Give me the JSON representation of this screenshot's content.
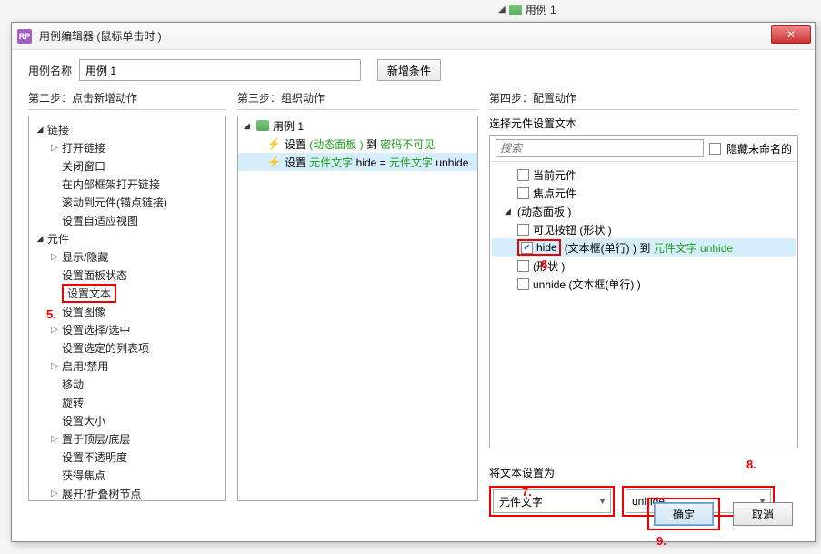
{
  "bg": {
    "usecase": "用例 1"
  },
  "dialog": {
    "app_icon_text": "RP",
    "title": "用例编辑器 (鼠标单击时  )",
    "close": "✕",
    "name_label": "用例名称",
    "name_value": "用例 1",
    "add_condition": "新增条件"
  },
  "col1": {
    "heading": "第二步：点击新增动作",
    "cat_link": "链接",
    "link_items": [
      "打开链接",
      "关闭窗口",
      "在内部框架打开链接",
      "滚动到元件(锚点链接)",
      "设置自适应视图"
    ],
    "cat_widget": "元件",
    "widget_items_before": [
      "显示/隐藏",
      "设置面板状态"
    ],
    "widget_highlight": "设置文本",
    "widget_items_after": [
      "设置图像",
      "设置选择/选中",
      "设置选定的列表项",
      "启用/禁用",
      "移动",
      "旋转",
      "设置大小",
      "置于顶层/底层",
      "设置不透明度",
      "获得焦点",
      "展开/折叠树节点"
    ]
  },
  "col2": {
    "heading": "第三步：组织动作",
    "case_label": "用例  1",
    "row1": {
      "pre": "设置 ",
      "g1": "(动态面板 )",
      "mid": " 到 ",
      "g2": "密码不可见"
    },
    "row2": {
      "pre": "设置 ",
      "g1": "元件文字",
      "mid": "  hide = ",
      "g2": "元件文字",
      "tail": "  unhide"
    }
  },
  "col3": {
    "heading": "第四步：配置动作",
    "select_label": "选择元件设置文本",
    "search_placeholder": "搜索",
    "hide_unnamed": "隐藏未命名的",
    "items": {
      "current": "当前元件",
      "focus": "焦点元件",
      "panel": "(动态面板 )",
      "visible_btn": "可见按钮 (形状 )",
      "hide_pre": "hide",
      "hide_mid": " (文本框(单行) ) 到 ",
      "hide_green": "元件文字  unhide",
      "shape": "(形状 )",
      "unhide": "unhide (文本框(单行) )"
    },
    "set_label": "将文本设置为",
    "combo1": "元件文字",
    "combo2": "unhide"
  },
  "buttons": {
    "ok": "确定",
    "cancel": "取消"
  },
  "markers": {
    "m5": "5.",
    "m6": "6.",
    "m7": "7.",
    "m8": "8.",
    "m9": "9."
  }
}
